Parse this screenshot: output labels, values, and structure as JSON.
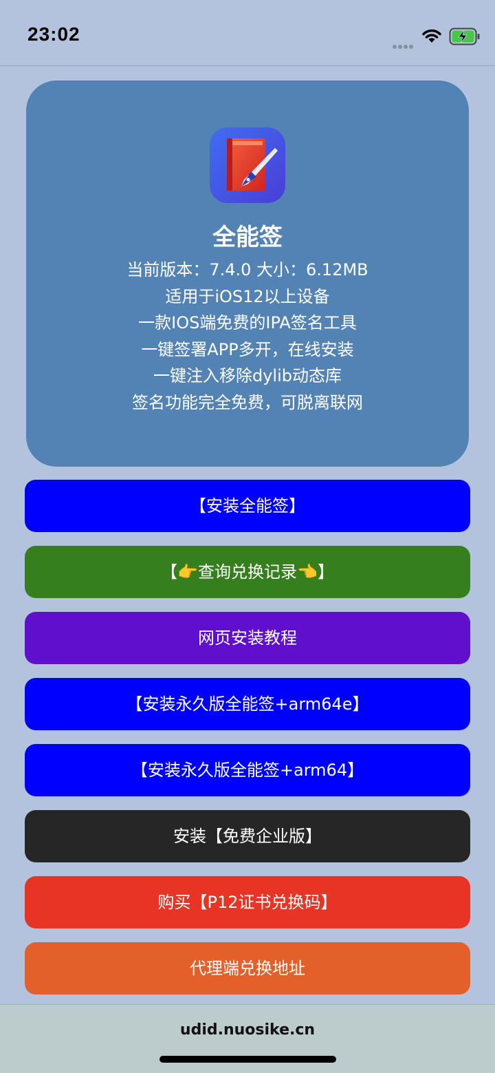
{
  "status_bar": {
    "time": "23:02",
    "icons": [
      "signal-dots-icon",
      "wifi-icon",
      "battery-charging-icon"
    ]
  },
  "app": {
    "icon": "pen-book-app-icon",
    "name": "全能签",
    "info_lines": [
      "当前版本：7.4.0   大小：6.12MB",
      "适用于iOS12以上设备",
      "一款IOS端免费的IPA签名工具",
      "一键签署APP多开，在线安装",
      "一键注入移除dylib动态库",
      "签名功能完全免费，可脱离联网"
    ]
  },
  "buttons": [
    {
      "label": "【安装全能签】",
      "color": "#0000ff"
    },
    {
      "label": "【👉查询兑换记录👈】",
      "color": "#367f1f"
    },
    {
      "label": "网页安装教程",
      "color": "#6010cc"
    },
    {
      "label": "【安装永久版全能签+arm64e】",
      "color": "#0000ff"
    },
    {
      "label": "【安装永久版全能签+arm64】",
      "color": "#0000ff"
    },
    {
      "label": "安装【免费企业版】",
      "color": "#262626"
    },
    {
      "label": "购买【P12证书兑换码】",
      "color": "#e73425"
    },
    {
      "label": "代理端兑换地址",
      "color": "#e4602a"
    }
  ],
  "footer": {
    "url": "udid.nuosike.cn"
  },
  "colors": {
    "page_background": "#b3c3dd",
    "card_background": "#5383b4",
    "footer_background": "#bccbcb"
  }
}
